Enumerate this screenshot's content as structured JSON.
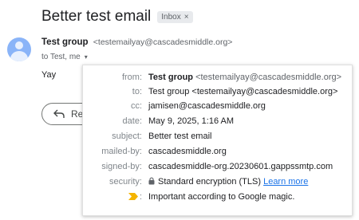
{
  "email": {
    "subject": "Better test email",
    "label": "Inbox",
    "label_close": "×",
    "sender_name": "Test group",
    "sender_email": "<testemailyay@cascadesmiddle.org>",
    "to_line": "to Test, me",
    "caret": "▾",
    "body": "Yay",
    "reply_label": "Reply"
  },
  "details": {
    "from": {
      "key": "from:",
      "name": "Test group",
      "email": "<testemailyay@cascadesmiddle.org>"
    },
    "to": {
      "key": "to:",
      "value": "Test group <testemailyay@cascadesmiddle.org>"
    },
    "cc": {
      "key": "cc:",
      "value": "jamisen@cascadesmiddle.org"
    },
    "date": {
      "key": "date:",
      "value": "May 9, 2025, 1:16 AM"
    },
    "subject": {
      "key": "subject:",
      "value": "Better test email"
    },
    "mailed_by": {
      "key": "mailed-by:",
      "value": "cascadesmiddle.org"
    },
    "signed_by": {
      "key": "signed-by:",
      "value": "cascadesmiddle-org.20230601.gappssmtp.com"
    },
    "security": {
      "key": "security:",
      "value": "Standard encryption (TLS)",
      "link": "Learn more",
      "icon": "lock-icon"
    },
    "importance": {
      "key": ":",
      "value": "Important according to Google magic.",
      "icon": "importance-marker-icon",
      "color": "#f4b400"
    }
  },
  "colors": {
    "avatar": "#8ab4f8",
    "link": "#1a73e8",
    "chip": "#e8eaed"
  }
}
